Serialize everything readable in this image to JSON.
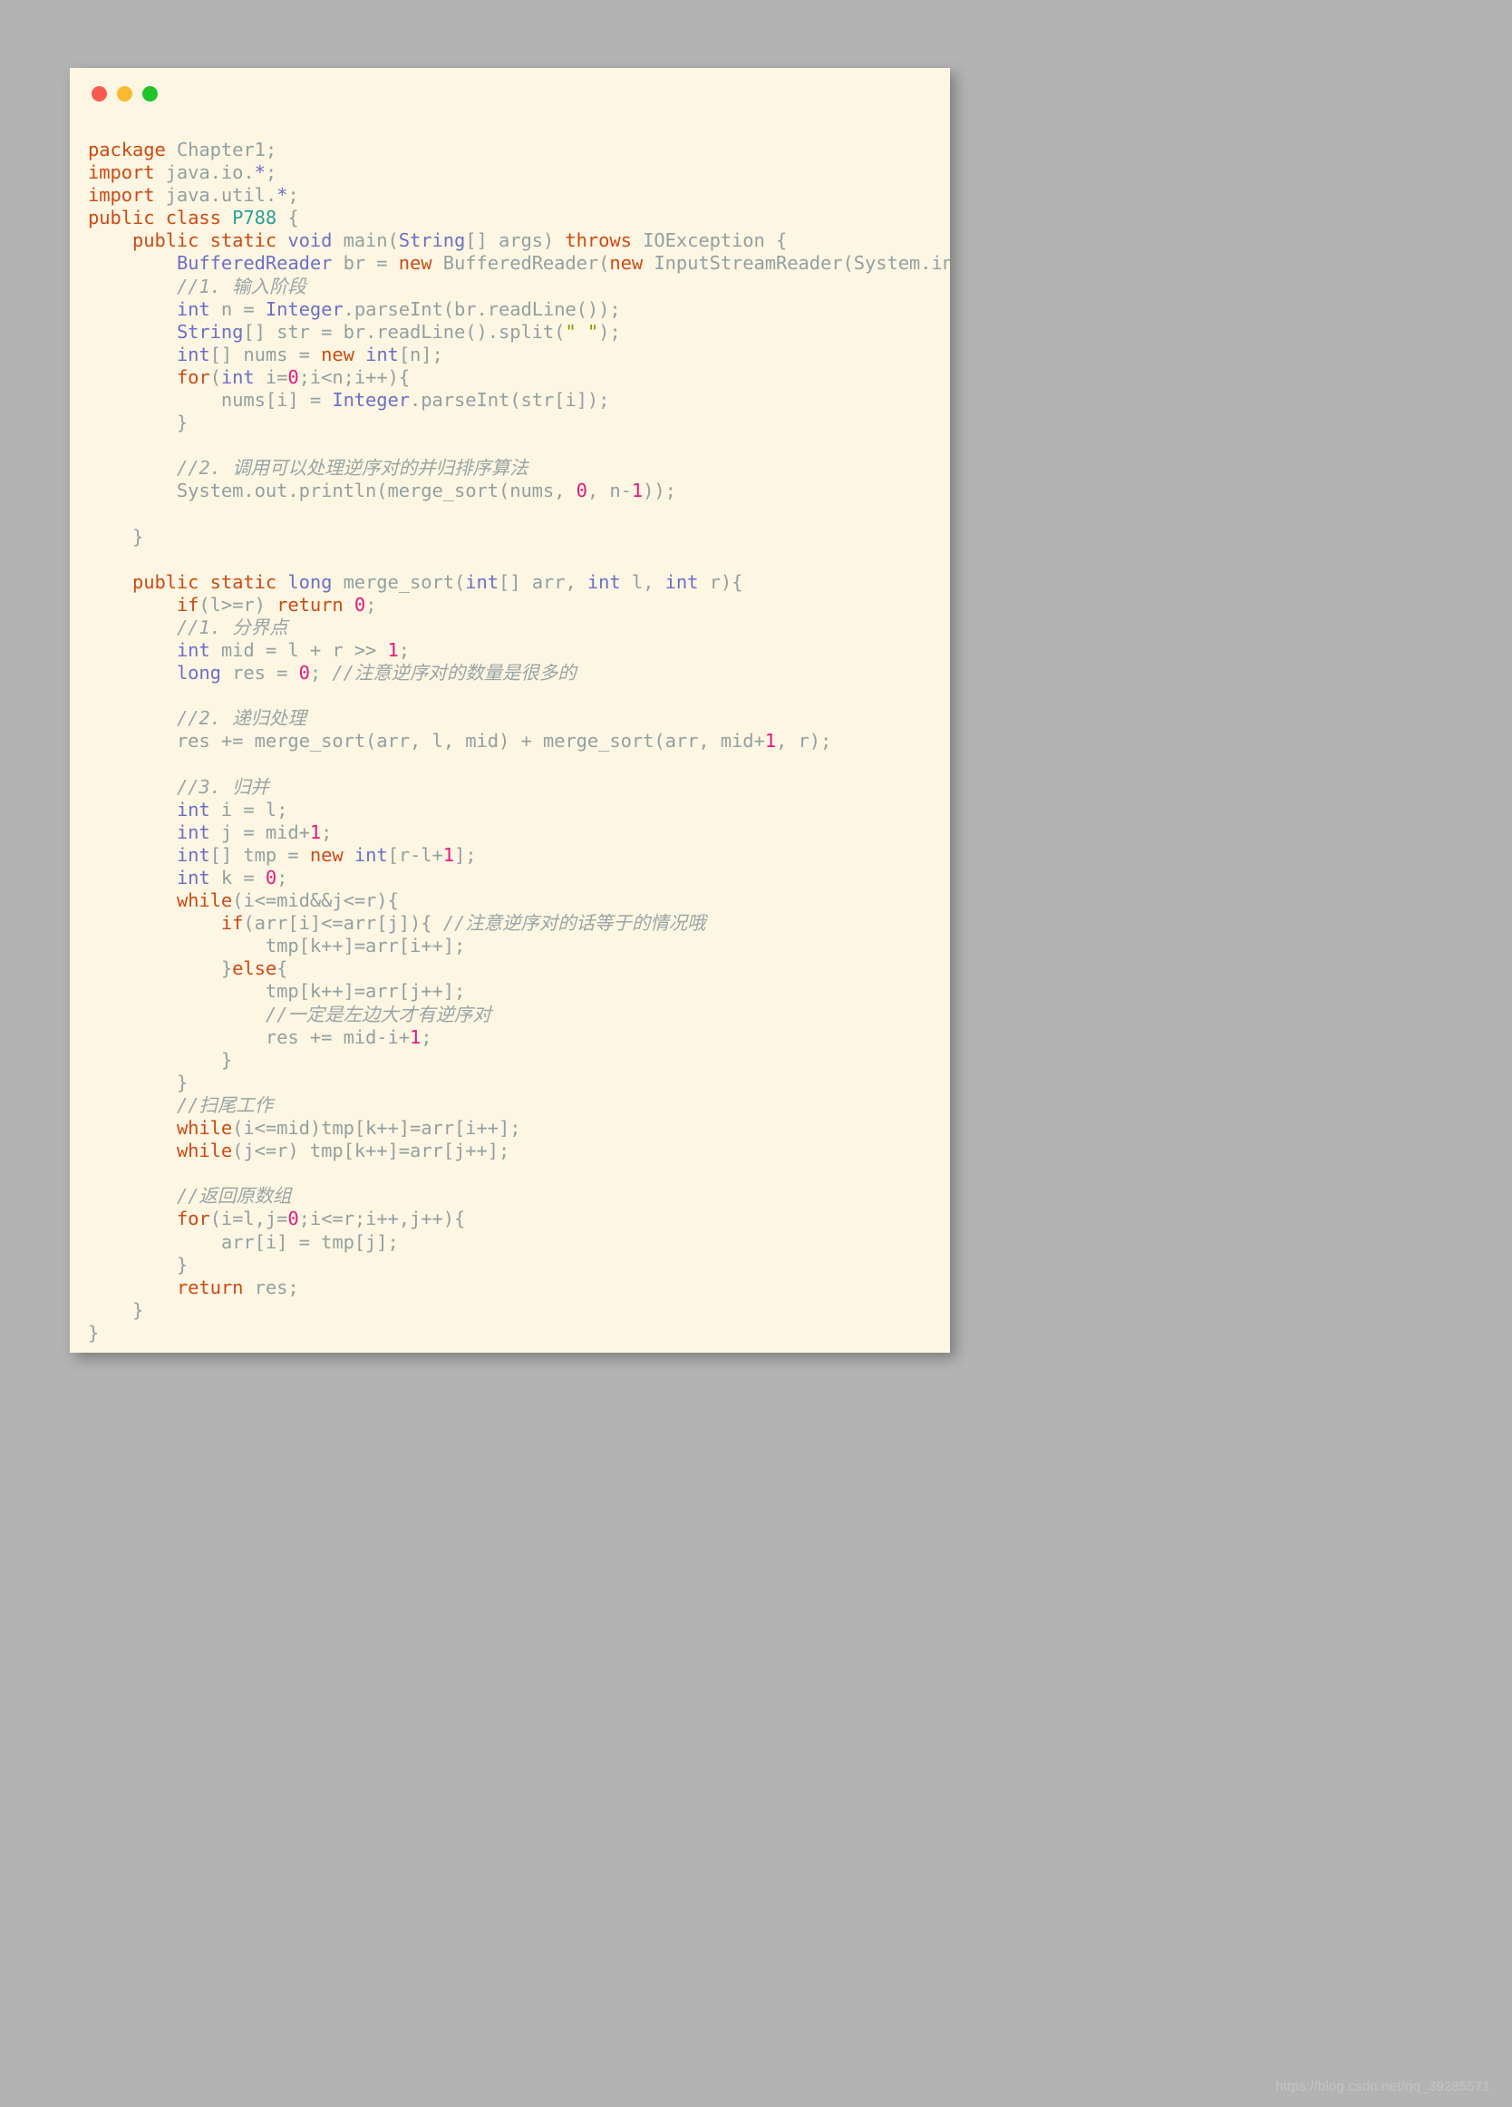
{
  "window": {
    "controls": [
      {
        "name": "close",
        "color": "#fb5a52"
      },
      {
        "name": "minimize",
        "color": "#f9bb2e"
      },
      {
        "name": "maximize",
        "color": "#1fc32b"
      }
    ],
    "background": "#fdf6e3"
  },
  "theme": {
    "keyword": "#cb4b16",
    "type": "#6c71c4",
    "class_name": "#2aa198",
    "number": "#e5197f",
    "identifier": "#93a1a1",
    "comment": "#9aa6a6",
    "string": "#8a9a00",
    "page_background": "#b3b3b3"
  },
  "watermark": "https://blog.csdn.net/qq_39285571",
  "code": {
    "language": "java",
    "lines": [
      [
        [
          "kw",
          "package"
        ],
        [
          "id",
          " Chapter1;"
        ]
      ],
      [
        [
          "kw",
          "import"
        ],
        [
          "id",
          " java.io."
        ],
        [
          "typ",
          "*"
        ],
        [
          "id",
          ";"
        ]
      ],
      [
        [
          "kw",
          "import"
        ],
        [
          "id",
          " java.util."
        ],
        [
          "typ",
          "*"
        ],
        [
          "id",
          ";"
        ]
      ],
      [
        [
          "kw",
          "public class "
        ],
        [
          "cls",
          "P788"
        ],
        [
          "id",
          " {"
        ]
      ],
      [
        [
          "id",
          "    "
        ],
        [
          "kw",
          "public static "
        ],
        [
          "typ",
          "void"
        ],
        [
          "id",
          " main("
        ],
        [
          "typ",
          "String"
        ],
        [
          "id",
          "[] args) "
        ],
        [
          "kw",
          "throws"
        ],
        [
          "id",
          " IOException {"
        ]
      ],
      [
        [
          "id",
          "        "
        ],
        [
          "typ",
          "BufferedReader"
        ],
        [
          "id",
          " br = "
        ],
        [
          "kw",
          "new"
        ],
        [
          "id",
          " BufferedReader("
        ],
        [
          "kw",
          "new"
        ],
        [
          "id",
          " InputStreamReader(System.in));"
        ]
      ],
      [
        [
          "id",
          "        "
        ],
        [
          "cmt",
          "//1. 输入阶段"
        ]
      ],
      [
        [
          "id",
          "        "
        ],
        [
          "typ",
          "int"
        ],
        [
          "id",
          " n = "
        ],
        [
          "typ",
          "Integer"
        ],
        [
          "id",
          ".parseInt(br.readLine());"
        ]
      ],
      [
        [
          "id",
          "        "
        ],
        [
          "typ",
          "String"
        ],
        [
          "id",
          "[] str = br.readLine().split("
        ],
        [
          "str",
          "\" \""
        ],
        [
          "id",
          ");"
        ]
      ],
      [
        [
          "id",
          "        "
        ],
        [
          "typ",
          "int"
        ],
        [
          "id",
          "[] nums = "
        ],
        [
          "kw",
          "new"
        ],
        [
          "id",
          " "
        ],
        [
          "typ",
          "int"
        ],
        [
          "id",
          "[n];"
        ]
      ],
      [
        [
          "id",
          "        "
        ],
        [
          "kw",
          "for"
        ],
        [
          "id",
          "("
        ],
        [
          "typ",
          "int"
        ],
        [
          "id",
          " i="
        ],
        [
          "num",
          "0"
        ],
        [
          "id",
          ";i<n;i++){"
        ]
      ],
      [
        [
          "id",
          "            nums[i] = "
        ],
        [
          "typ",
          "Integer"
        ],
        [
          "id",
          ".parseInt(str[i]);"
        ]
      ],
      [
        [
          "id",
          "        }"
        ]
      ],
      [
        [
          "id",
          ""
        ]
      ],
      [
        [
          "id",
          "        "
        ],
        [
          "cmt",
          "//2. 调用可以处理逆序对的并归排序算法"
        ]
      ],
      [
        [
          "id",
          "        System.out.println(merge_sort(nums, "
        ],
        [
          "num",
          "0"
        ],
        [
          "id",
          ", n-"
        ],
        [
          "num",
          "1"
        ],
        [
          "id",
          "));"
        ]
      ],
      [
        [
          "id",
          ""
        ]
      ],
      [
        [
          "id",
          "    }"
        ]
      ],
      [
        [
          "id",
          ""
        ]
      ],
      [
        [
          "id",
          "    "
        ],
        [
          "kw",
          "public static "
        ],
        [
          "typ",
          "long"
        ],
        [
          "id",
          " merge_sort("
        ],
        [
          "typ",
          "int"
        ],
        [
          "id",
          "[] arr, "
        ],
        [
          "typ",
          "int"
        ],
        [
          "id",
          " l, "
        ],
        [
          "typ",
          "int"
        ],
        [
          "id",
          " r){"
        ]
      ],
      [
        [
          "id",
          "        "
        ],
        [
          "kw",
          "if"
        ],
        [
          "id",
          "(l>=r) "
        ],
        [
          "kw",
          "return"
        ],
        [
          "id",
          " "
        ],
        [
          "num",
          "0"
        ],
        [
          "id",
          ";"
        ]
      ],
      [
        [
          "id",
          "        "
        ],
        [
          "cmt",
          "//1. 分界点"
        ]
      ],
      [
        [
          "id",
          "        "
        ],
        [
          "typ",
          "int"
        ],
        [
          "id",
          " mid = l + r >> "
        ],
        [
          "num",
          "1"
        ],
        [
          "id",
          ";"
        ]
      ],
      [
        [
          "id",
          "        "
        ],
        [
          "typ",
          "long"
        ],
        [
          "id",
          " res = "
        ],
        [
          "num",
          "0"
        ],
        [
          "id",
          "; "
        ],
        [
          "cmt",
          "//注意逆序对的数量是很多的"
        ]
      ],
      [
        [
          "id",
          ""
        ]
      ],
      [
        [
          "id",
          "        "
        ],
        [
          "cmt",
          "//2. 递归处理"
        ]
      ],
      [
        [
          "id",
          "        res += merge_sort(arr, l, mid) + merge_sort(arr, mid+"
        ],
        [
          "num",
          "1"
        ],
        [
          "id",
          ", r);"
        ]
      ],
      [
        [
          "id",
          ""
        ]
      ],
      [
        [
          "id",
          "        "
        ],
        [
          "cmt",
          "//3. 归并"
        ]
      ],
      [
        [
          "id",
          "        "
        ],
        [
          "typ",
          "int"
        ],
        [
          "id",
          " i = l;"
        ]
      ],
      [
        [
          "id",
          "        "
        ],
        [
          "typ",
          "int"
        ],
        [
          "id",
          " j = mid+"
        ],
        [
          "num",
          "1"
        ],
        [
          "id",
          ";"
        ]
      ],
      [
        [
          "id",
          "        "
        ],
        [
          "typ",
          "int"
        ],
        [
          "id",
          "[] tmp = "
        ],
        [
          "kw",
          "new"
        ],
        [
          "id",
          " "
        ],
        [
          "typ",
          "int"
        ],
        [
          "id",
          "[r-l+"
        ],
        [
          "num",
          "1"
        ],
        [
          "id",
          "];"
        ]
      ],
      [
        [
          "id",
          "        "
        ],
        [
          "typ",
          "int"
        ],
        [
          "id",
          " k = "
        ],
        [
          "num",
          "0"
        ],
        [
          "id",
          ";"
        ]
      ],
      [
        [
          "id",
          "        "
        ],
        [
          "kw",
          "while"
        ],
        [
          "id",
          "(i<=mid&&j<=r){"
        ]
      ],
      [
        [
          "id",
          "            "
        ],
        [
          "kw",
          "if"
        ],
        [
          "id",
          "(arr[i]<=arr[j]){ "
        ],
        [
          "cmt",
          "//注意逆序对的话等于的情况哦"
        ]
      ],
      [
        [
          "id",
          "                tmp[k++]=arr[i++];"
        ]
      ],
      [
        [
          "id",
          "            }"
        ],
        [
          "kw",
          "else"
        ],
        [
          "id",
          "{"
        ]
      ],
      [
        [
          "id",
          "                tmp[k++]=arr[j++];"
        ]
      ],
      [
        [
          "id",
          "                "
        ],
        [
          "cmt",
          "//一定是左边大才有逆序对"
        ]
      ],
      [
        [
          "id",
          "                res += mid-i+"
        ],
        [
          "num",
          "1"
        ],
        [
          "id",
          ";"
        ]
      ],
      [
        [
          "id",
          "            }"
        ]
      ],
      [
        [
          "id",
          "        }"
        ]
      ],
      [
        [
          "id",
          "        "
        ],
        [
          "cmt",
          "//扫尾工作"
        ]
      ],
      [
        [
          "id",
          "        "
        ],
        [
          "kw",
          "while"
        ],
        [
          "id",
          "(i<=mid)tmp[k++]=arr[i++];"
        ]
      ],
      [
        [
          "id",
          "        "
        ],
        [
          "kw",
          "while"
        ],
        [
          "id",
          "(j<=r) tmp[k++]=arr[j++];"
        ]
      ],
      [
        [
          "id",
          ""
        ]
      ],
      [
        [
          "id",
          "        "
        ],
        [
          "cmt",
          "//返回原数组"
        ]
      ],
      [
        [
          "id",
          "        "
        ],
        [
          "kw",
          "for"
        ],
        [
          "id",
          "(i=l,j="
        ],
        [
          "num",
          "0"
        ],
        [
          "id",
          ";i<=r;i++,j++){"
        ]
      ],
      [
        [
          "id",
          "            arr[i] = tmp[j];"
        ]
      ],
      [
        [
          "id",
          "        }"
        ]
      ],
      [
        [
          "id",
          "        "
        ],
        [
          "kw",
          "return"
        ],
        [
          "id",
          " res;"
        ]
      ],
      [
        [
          "id",
          "    }"
        ]
      ],
      [
        [
          "id",
          "}"
        ]
      ]
    ]
  }
}
